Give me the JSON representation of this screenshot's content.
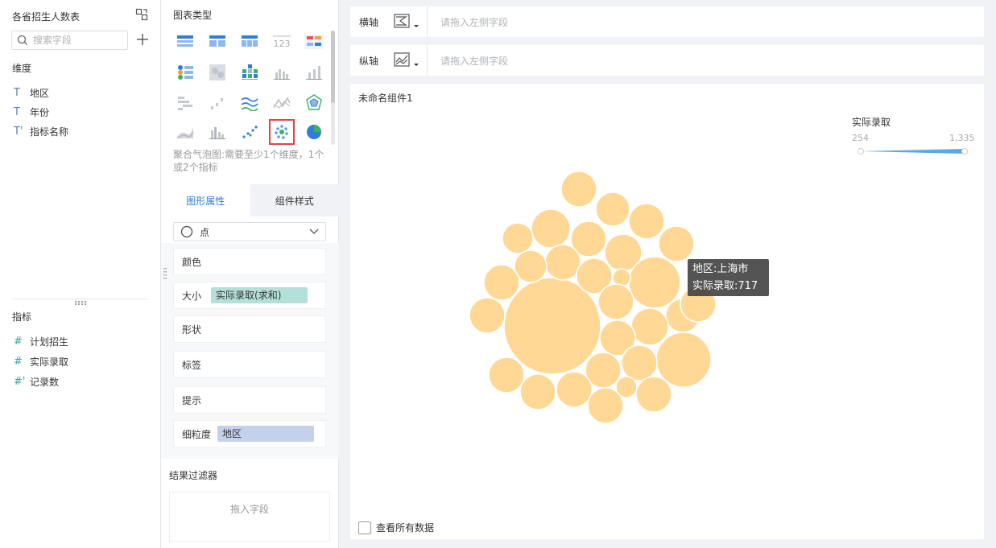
{
  "left": {
    "title": "各省招生人数表",
    "search_placeholder": "搜索字段",
    "dimension_label": "维度",
    "dimensions": [
      {
        "icon": "T",
        "label": "地区"
      },
      {
        "icon": "T",
        "label": "年份"
      },
      {
        "icon": "T'",
        "label": "指标名称"
      }
    ],
    "measure_label": "指标",
    "measures": [
      {
        "icon": "#",
        "label": "计划招生"
      },
      {
        "icon": "#",
        "label": "实际录取"
      },
      {
        "icon": "#'",
        "label": "记录数"
      }
    ]
  },
  "middle": {
    "chart_type_title": "图表类型",
    "chart_desc": "聚合气泡图:需要至少1个维度，1个或2个指标",
    "tabs": [
      "图形属性",
      "组件样式"
    ],
    "shape_select": "点",
    "props": {
      "color": "颜色",
      "size": "大小",
      "size_field": "实际录取(求和)",
      "shape": "形状",
      "label": "标签",
      "tip": "提示",
      "granularity": "细粒度",
      "granularity_field": "地区"
    },
    "filter_title": "结果过滤器",
    "filter_hint": "拖入字段"
  },
  "axes": {
    "x_label": "横轴",
    "y_label": "纵轴",
    "hint": "请拖入左侧字段"
  },
  "canvas": {
    "widget_title": "未命名组件1",
    "legend_title": "实际录取",
    "legend_min": "254",
    "legend_max": "1,335",
    "tooltip_line1": "地区:上海市",
    "tooltip_line2": "实际录取:717",
    "view_all": "查看所有数据",
    "bubble_color": "#ffd896",
    "legend_color": "#5aa8ea"
  }
}
